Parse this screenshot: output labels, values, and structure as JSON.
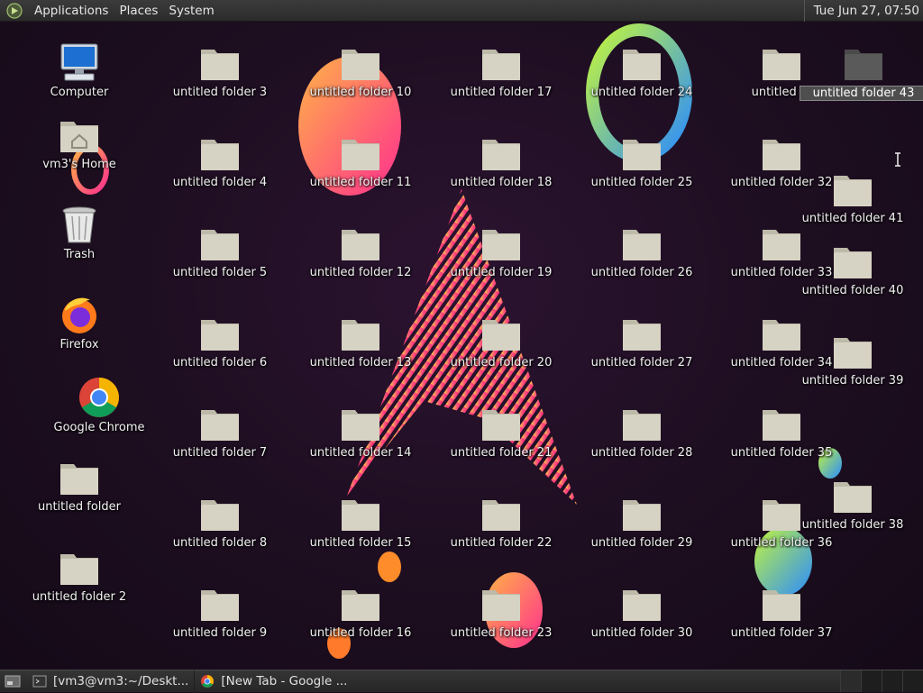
{
  "top_panel": {
    "menus": [
      "Applications",
      "Places",
      "System"
    ],
    "clock": "Tue Jun 27, 07:50"
  },
  "desktop": {
    "system_icons": [
      {
        "label": "Computer",
        "icon": "computer-icon"
      },
      {
        "label": "vm3's Home",
        "icon": "home-folder-icon"
      },
      {
        "label": "Trash",
        "icon": "trash-icon"
      },
      {
        "label": "Firefox",
        "icon": "firefox-icon"
      },
      {
        "label": "Google Chrome",
        "icon": "chrome-icon"
      },
      {
        "label": "untitled folder",
        "icon": "folder-icon"
      },
      {
        "label": "untitled folder 2",
        "icon": "folder-icon"
      }
    ],
    "folders_col1": [
      "untitled folder 3",
      "untitled folder 4",
      "untitled folder 5",
      "untitled folder 6",
      "untitled folder 7",
      "untitled folder 8",
      "untitled folder 9"
    ],
    "folders_col2": [
      "untitled folder 10",
      "untitled folder 11",
      "untitled folder 12",
      "untitled folder 13",
      "untitled folder 14",
      "untitled folder 15",
      "untitled folder 16"
    ],
    "folders_col3": [
      "untitled folder 17",
      "untitled folder 18",
      "untitled folder 19",
      "untitled folder 20",
      "untitled folder 21",
      "untitled folder 22",
      "untitled folder 23"
    ],
    "folders_col4": [
      "untitled folder 24",
      "untitled folder 25",
      "untitled folder 26",
      "untitled folder 27",
      "untitled folder 28",
      "untitled folder 29",
      "untitled folder 30"
    ],
    "folders_col5": [
      "untitled fo",
      "untitled folder 32",
      "untitled folder 33",
      "untitled folder 34",
      "untitled folder 35",
      "untitled folder 36",
      "untitled folder 37"
    ],
    "folders_col6": [
      {
        "label": "untitled folder 43",
        "selected": true
      },
      {
        "label": "untitled folder 41"
      },
      {
        "label": "untitled folder 40"
      },
      {
        "label": "untitled folder 39"
      },
      {
        "label": "untitled folder 38"
      }
    ]
  },
  "bottom_panel": {
    "tasks": [
      {
        "label": "[vm3@vm3:~/Deskt...",
        "icon": "terminal-icon"
      },
      {
        "label": "[New Tab - Google ...",
        "icon": "chrome-icon"
      }
    ]
  },
  "colors": {
    "panel": "#2b2b2b",
    "folder": "#d6d3c4",
    "folder_selected": "#5a5a5a"
  }
}
